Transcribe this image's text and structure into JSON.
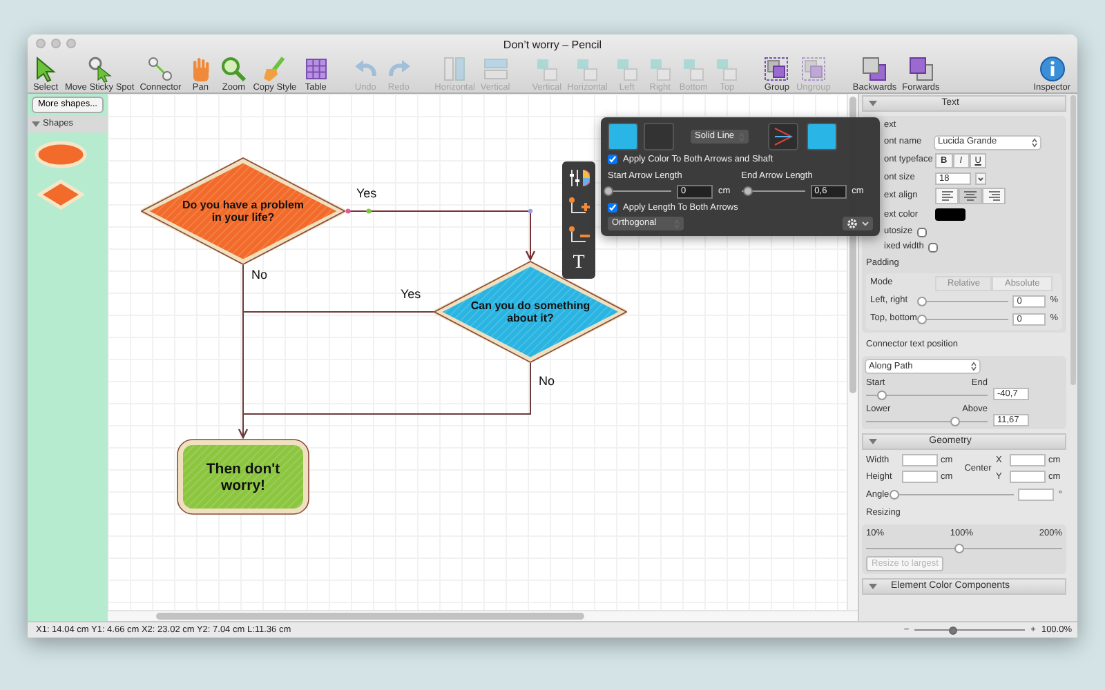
{
  "window": {
    "title": "Don’t worry – Pencil"
  },
  "toolbar": [
    [
      {
        "label": "Select",
        "kind": "pointer",
        "disabled": false
      },
      {
        "label": "Move Sticky Spot",
        "kind": "sticky",
        "disabled": false
      },
      {
        "label": "Connector",
        "kind": "connector",
        "disabled": false
      },
      {
        "label": "Pan",
        "kind": "hand",
        "disabled": false
      },
      {
        "label": "Zoom",
        "kind": "zoom",
        "disabled": false
      },
      {
        "label": "Copy Style",
        "kind": "brush",
        "disabled": false
      },
      {
        "label": "Table",
        "kind": "table",
        "disabled": false
      }
    ],
    [
      {
        "label": "Undo",
        "kind": "undo",
        "disabled": true
      },
      {
        "label": "Redo",
        "kind": "redo",
        "disabled": true
      }
    ],
    [
      {
        "label": "Horizontal",
        "kind": "split-h",
        "disabled": true
      },
      {
        "label": "Vertical",
        "kind": "split-v",
        "disabled": true
      }
    ],
    [
      {
        "label": "Vertical",
        "kind": "align",
        "disabled": true
      },
      {
        "label": "Horizontal",
        "kind": "align",
        "disabled": true
      },
      {
        "label": "Left",
        "kind": "align",
        "disabled": true
      },
      {
        "label": "Right",
        "kind": "align",
        "disabled": true
      },
      {
        "label": "Bottom",
        "kind": "align",
        "disabled": true
      },
      {
        "label": "Top",
        "kind": "align",
        "disabled": true
      }
    ],
    [
      {
        "label": "Group",
        "kind": "group",
        "disabled": false
      },
      {
        "label": "Ungroup",
        "kind": "group",
        "disabled": true
      }
    ],
    [
      {
        "label": "Backwards",
        "kind": "backwards",
        "disabled": false
      },
      {
        "label": "Forwards",
        "kind": "forwards",
        "disabled": false
      }
    ],
    [
      {
        "label": "Inspector",
        "kind": "info",
        "disabled": false
      }
    ]
  ],
  "shapes_panel": {
    "button": "More shapes...",
    "header": "Shapes",
    "expanded": true,
    "shapes": [
      {
        "kind": "ellipse"
      },
      {
        "kind": "diamond"
      }
    ]
  },
  "diagram": {
    "nodes": [
      {
        "kind": "decision",
        "text": "Do you have a problem in your life?",
        "color": "#f26b2a"
      },
      {
        "kind": "decision",
        "text": "Can you do something about it?",
        "color": "#2ab4e2"
      },
      {
        "kind": "terminal",
        "text": "Then don't worry!",
        "color": "#8cc63f"
      }
    ],
    "connectors": [
      {
        "label": "Yes",
        "selected": true
      },
      {
        "label": "Yes",
        "selected": false
      },
      {
        "label": "No",
        "selected": false
      },
      {
        "label": "No",
        "selected": false
      }
    ]
  },
  "popup": {
    "tools": [
      {
        "kind": "style"
      },
      {
        "kind": "add-point"
      },
      {
        "kind": "remove-point"
      },
      {
        "kind": "text",
        "label": "T"
      }
    ],
    "swatches": [
      {
        "color": "#29b5e6"
      },
      {
        "color": "#333333"
      }
    ],
    "line_style": "Solid Line",
    "end_swatch": {
      "color": "#29b5e6"
    },
    "apply_color": {
      "label": "Apply Color To Both Arrows and Shaft",
      "checked": true
    },
    "arrows": [
      {
        "label": "Start Arrow Length",
        "level": 0,
        "value": "0",
        "unit": "cm"
      },
      {
        "label": "End Arrow Length",
        "level": 0.1,
        "value": "0,6",
        "unit": "cm"
      }
    ],
    "apply_length": {
      "label": "Apply Length To Both Arrows",
      "checked": true
    },
    "routing": "Orthogonal"
  },
  "inspector": {
    "text_section": {
      "title": "Text",
      "expanded": true,
      "group_label": "ext",
      "font_name_label": "ont name",
      "font_name": "Lucida Grande",
      "typeface_label": "ont typeface",
      "typeface": [
        {
          "label": "B",
          "selected": false
        },
        {
          "label": "I",
          "selected": false
        },
        {
          "label": "U",
          "selected": false
        }
      ],
      "size_label": "ont size",
      "size": "18",
      "align_label": "ext align",
      "align": [
        {
          "kind": "left",
          "selected": false
        },
        {
          "kind": "center",
          "selected": true
        },
        {
          "kind": "right",
          "selected": false
        }
      ],
      "color_label": "ext color",
      "options": [
        {
          "label": "utosize",
          "checked": false
        },
        {
          "label": "ixed width",
          "checked": false
        }
      ],
      "padding": {
        "label": "Padding",
        "mode_label": "Mode",
        "modes": [
          {
            "label": "Relative",
            "selected": false
          },
          {
            "label": "Absolute",
            "selected": true
          }
        ],
        "rows": [
          {
            "label": "Left, right",
            "level": 0,
            "value": "0",
            "unit": "%"
          },
          {
            "label": "Top, bottom",
            "level": 0,
            "value": "0",
            "unit": "%"
          }
        ]
      },
      "connector_text": {
        "label": "Connector text position",
        "mode": "Along Path",
        "rows": [
          {
            "low": "Start",
            "high": "End",
            "level": 0.12,
            "value": "-40,7"
          },
          {
            "low": "Lower",
            "high": "Above",
            "level": 0.73,
            "value": "11,67"
          }
        ]
      }
    },
    "geometry": {
      "title": "Geometry",
      "expanded": true,
      "rows": [
        {
          "label": "Width",
          "unit": "cm",
          "coord": "X",
          "coord_unit": "cm"
        },
        {
          "label": "Height",
          "unit": "cm",
          "coord": "Y",
          "coord_unit": "cm"
        }
      ],
      "center": "Center",
      "angle": {
        "label": "Angle",
        "level": 0,
        "unit": "°"
      },
      "resizing": {
        "label": "Resizing",
        "ticks": [
          "10%",
          "100%",
          "200%"
        ],
        "level": 0.47,
        "button": "Resize to largest",
        "disabled": true
      }
    },
    "color_section": {
      "title": "Element Color Components",
      "expanded": true
    }
  },
  "status_bar": {
    "text": "X1: 14.04 cm Y1: 4.66 cm X2: 23.02 cm Y2: 7.04 cm L:11.36 cm",
    "zoom_out": "−",
    "zoom_in": "+",
    "zoom_slider": {
      "level": 0.35
    },
    "zoom": "100.0%"
  }
}
